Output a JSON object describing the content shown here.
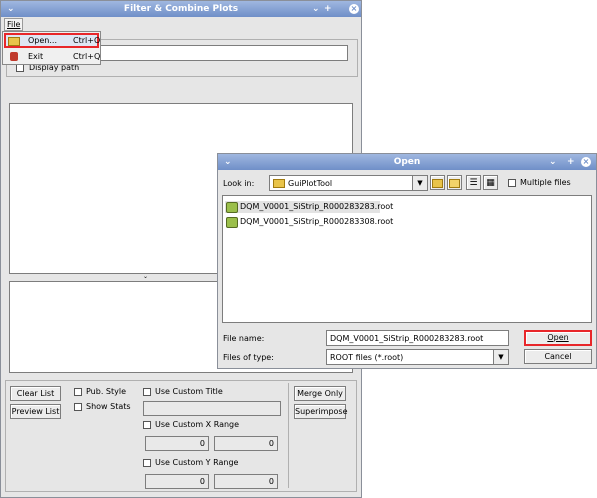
{
  "main": {
    "title": "Filter & Combine Plots",
    "controls": {
      "minimize": "⌄",
      "maximize": "+",
      "close": "×"
    },
    "menu_file": "File",
    "checkbox_display_path": "Display path",
    "buttons": {
      "clear_list": "Clear List",
      "preview_list": "Preview List",
      "merge_only": "Merge Only",
      "superimpose": "Superimpose"
    },
    "options": {
      "pub_style": "Pub. Style",
      "show_stats": "Show Stats",
      "use_custom_title": "Use Custom Title",
      "use_custom_x_range": "Use Custom X Range",
      "use_custom_y_range": "Use Custom Y Range"
    },
    "x_range": {
      "min": "0",
      "max": "0"
    },
    "y_range": {
      "min": "0",
      "max": "0"
    }
  },
  "file_menu": {
    "items": [
      {
        "label": "Open...",
        "shortcut": "Ctrl+O"
      },
      {
        "label": "Exit",
        "shortcut": "Ctrl+Q"
      }
    ]
  },
  "open_dialog": {
    "title": "Open",
    "look_in_label": "Look in:",
    "look_in_value": "GuiPlotTool",
    "multiple_files_label": "Multiple files",
    "files": [
      "DQM_V0001_SiStrip_R000283283.root",
      "DQM_V0001_SiStrip_R000283308.root"
    ],
    "file_name_label": "File name:",
    "file_name_value": "DQM_V0001_SiStrip_R000283283.root",
    "files_of_type_label": "Files of type:",
    "files_of_type_value": "ROOT files (*.root)",
    "open_button": "Open",
    "cancel_button": "Cancel"
  },
  "colors": {
    "highlight": "#e8262a",
    "titlebar": "#6f8fc8"
  }
}
